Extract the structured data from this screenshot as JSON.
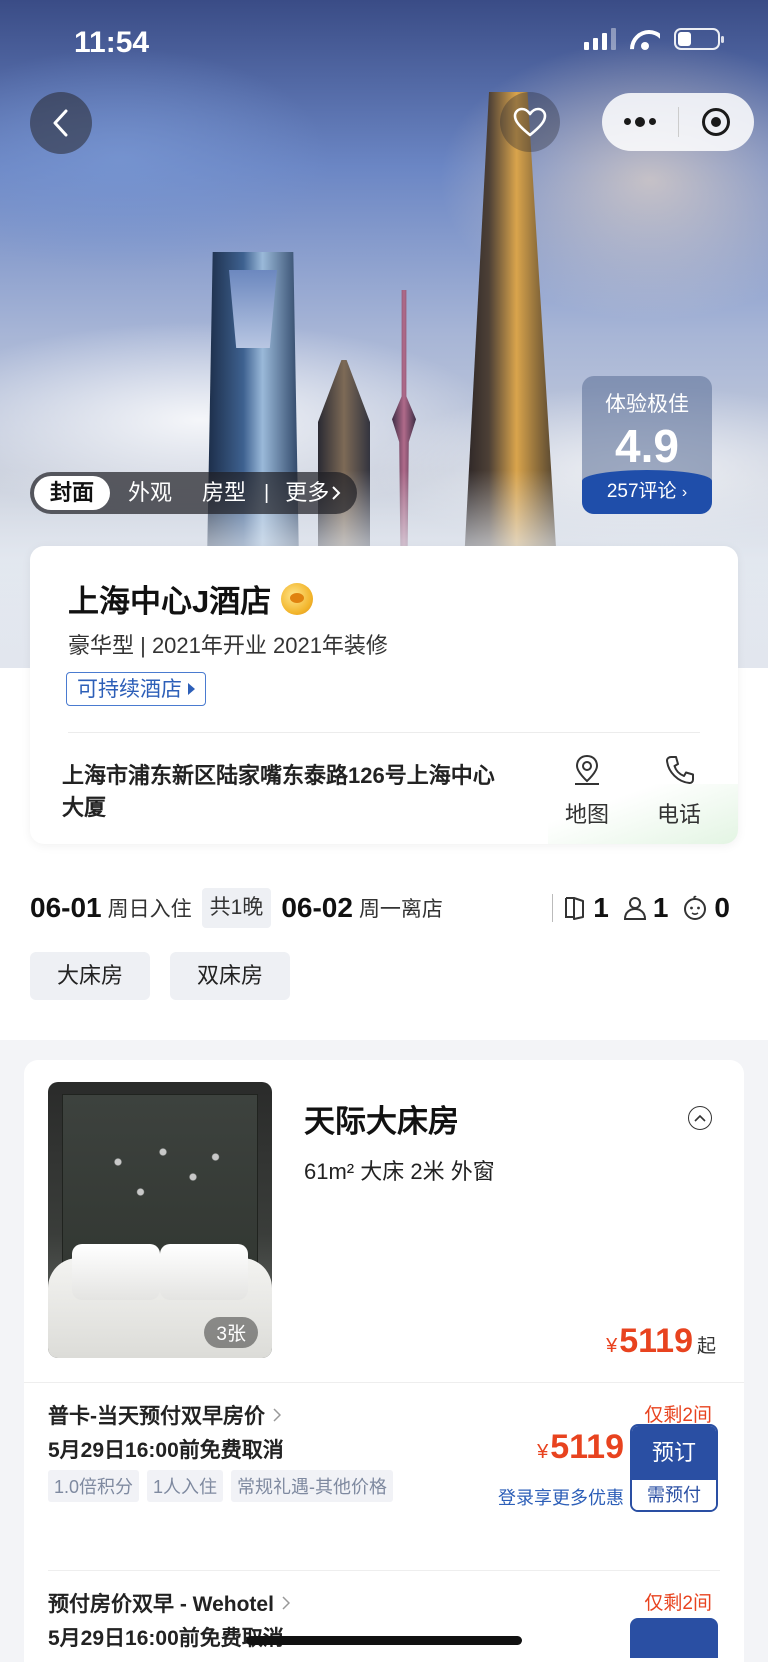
{
  "status_bar": {
    "time": "11:54"
  },
  "hero": {
    "photo_tabs": [
      "封面",
      "外观",
      "房型"
    ],
    "more_label": "更多",
    "rating_label": "体验极佳",
    "rating_score": "4.9",
    "review_count": "257评论"
  },
  "hotel": {
    "name": "上海中心J酒店",
    "subtitle": "豪华型 | 2021年开业 2021年装修",
    "eco_tag": "可持续酒店",
    "address": "上海市浦东新区陆家嘴东泰路126号上海中心大厦",
    "map_label": "地图",
    "phone_label": "电话"
  },
  "stay": {
    "checkin_date": "06-01",
    "checkin_text": "周日入住",
    "nights": "共1晚",
    "checkout_date": "06-02",
    "checkout_text": "周一离店",
    "rooms": "1",
    "adults": "1",
    "children": "0"
  },
  "bed_filters": [
    "大床房",
    "双床房"
  ],
  "room": {
    "title": "天际大床房",
    "spec": "61m² 大床 2米 外窗",
    "photo_count": "3张",
    "currency": "¥",
    "price": "5119",
    "price_suffix": "起"
  },
  "rates": [
    {
      "name": "普卡-当天预付双早房价",
      "cancel": "5月29日16:00前免费取消",
      "tags": [
        "1.0倍积分",
        "1人入住",
        "常规礼遇-其他价格"
      ],
      "remaining": "仅剩2间",
      "price": "5119",
      "login_deal": "登录享更多优惠",
      "book_label": "预订",
      "book_sub": "需预付"
    },
    {
      "name": "预付房价双早 - Wehotel",
      "cancel": "5月29日16:00前免费取消",
      "remaining": "仅剩2间"
    }
  ]
}
